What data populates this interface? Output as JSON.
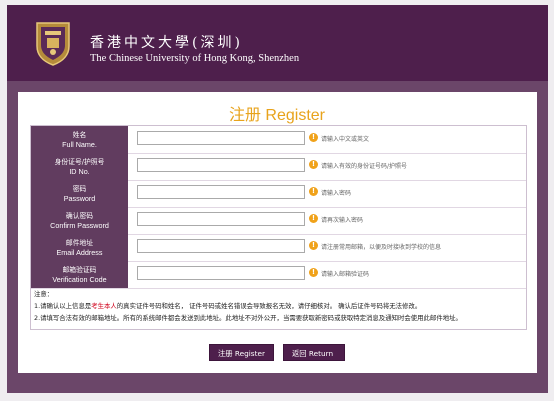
{
  "header": {
    "university_cn": "香港中文大學(深圳)",
    "university_en": "The Chinese University of Hong Kong, Shenzhen"
  },
  "title": "注册 Register",
  "fields": [
    {
      "label_cn": "姓名",
      "label_en": "Full Name.",
      "hint": "请输入中文或英文"
    },
    {
      "label_cn": "身份证号/护照号",
      "label_en": "ID No.",
      "hint": "请输入有效的身份证号码/护照号"
    },
    {
      "label_cn": "密码",
      "label_en": "Password",
      "hint": "请输入密码"
    },
    {
      "label_cn": "确认密码",
      "label_en": "Confirm Password",
      "hint": "请再次输入密码"
    },
    {
      "label_cn": "邮件地址",
      "label_en": "Email Address",
      "hint": "请注册常用邮箱，以便及时接收到学校的信息"
    },
    {
      "label_cn": "邮箱验证码",
      "label_en": "Verification Code",
      "hint": "请输入邮箱验证码"
    }
  ],
  "notes": {
    "heading": "注意：",
    "line1_pre": "1.请确认以上信息是",
    "line1_red": "考生本人",
    "line1_post": "的真实证件号码和姓名， 证件号码或姓名错误会导致报名无效，请仔细核对。 确认后证件号码将无法修改。",
    "line2": "2.请填写合法有效的邮箱地址。所有的系统邮件都会发送到此地址。此地址不对外公开，当需要获取新密码或获取特定消息及通知时会使用此邮件地址。"
  },
  "buttons": {
    "register": "注册 Register",
    "return": "返回 Return"
  },
  "colors": {
    "brand_purple": "#4e1f4c",
    "label_purple": "#613c5f",
    "accent_orange": "#e8a31c"
  }
}
